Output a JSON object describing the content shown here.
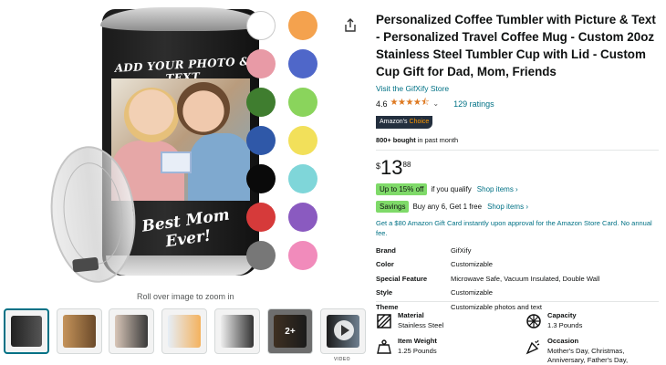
{
  "product": {
    "title": "Personalized Coffee Tumbler with Picture & Text - Personalized Travel Coffee Mug - Custom 20oz Stainless Steel Tumbler Cup with Lid - Custom Cup Gift for Dad, Mom, Friends",
    "store_link": "Visit the GifXify Store",
    "rating": "4.6",
    "stars": "★★★★⯪",
    "rating_count": "129 ratings",
    "badge_prefix": "Amazon's",
    "badge_choice": "Choice",
    "bought_bold": "800+ bought",
    "bought_rest": " in past month",
    "price_symbol": "$",
    "price_whole": "13",
    "price_fraction": "88"
  },
  "image": {
    "top_text": "ADD YOUR PHOTO & TEXT",
    "bottom_text": "Best Mom Ever!",
    "zoom_hint": "Roll over image to zoom in",
    "thumbnail_plus": "2+",
    "video_label": "VIDEO"
  },
  "swatches": [
    "#ffffff",
    "#f4a24e",
    "#e89aa6",
    "#4f67c9",
    "#3f7d2f",
    "#8ad45c",
    "#2f58a8",
    "#f2e05a",
    "#0a0a0a",
    "#7fd6d9",
    "#d63a3a",
    "#8a5ac0",
    "#777777",
    "#f18bbb"
  ],
  "promos": {
    "discount_badge": "Up to 15% off",
    "discount_text": "if you qualify",
    "discount_link": "Shop items ›",
    "savings_badge": "Savings",
    "savings_text": "Buy any 6, Get 1 free",
    "savings_link": "Shop items ›",
    "card_offer": "Get a $80 Amazon Gift Card instantly upon approval for the Amazon Store Card. No annual fee."
  },
  "specs": [
    {
      "key": "Brand",
      "value": "GifXify"
    },
    {
      "key": "Color",
      "value": "Customizable"
    },
    {
      "key": "Special Feature",
      "value": "Microwave Safe, Vacuum Insulated, Double Wall"
    },
    {
      "key": "Style",
      "value": "Customizable"
    },
    {
      "key": "Theme",
      "value": "Customizable photos and text"
    }
  ],
  "features": [
    {
      "icon": "material-icon",
      "key": "Material",
      "value": "Stainless Steel"
    },
    {
      "icon": "capacity-icon",
      "key": "Capacity",
      "value": "1.3 Pounds"
    },
    {
      "icon": "weight-icon",
      "key": "Item Weight",
      "value": "1.25 Pounds"
    },
    {
      "icon": "occasion-icon",
      "key": "Occasion",
      "value": "Mother's Day, Christmas, Anniversary, Father's Day,"
    }
  ]
}
